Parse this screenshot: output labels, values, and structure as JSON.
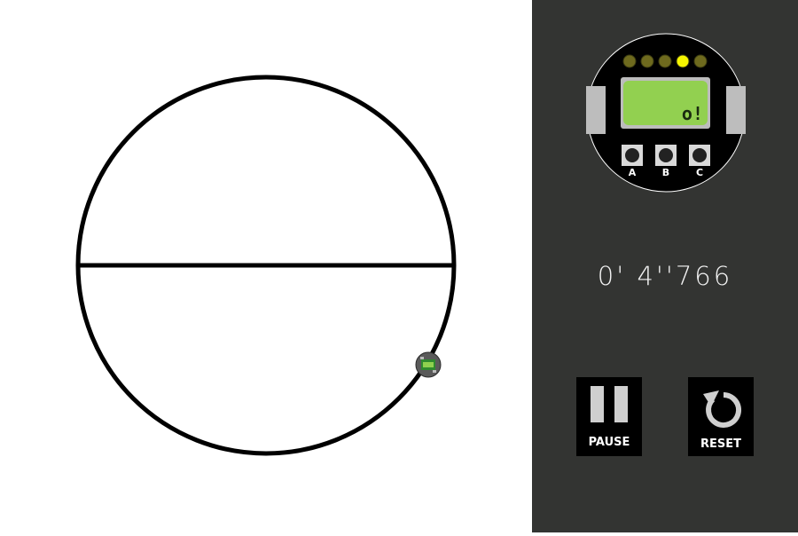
{
  "timer": {
    "text": "0' 4''766"
  },
  "robot": {
    "lcd_text": "o!",
    "button_labels": [
      "A",
      "B",
      "C"
    ],
    "leds": [
      {
        "name": "led-1",
        "on": false
      },
      {
        "name": "led-2",
        "on": false
      },
      {
        "name": "led-3",
        "on": false
      },
      {
        "name": "led-4",
        "on": true
      },
      {
        "name": "led-5",
        "on": false
      }
    ]
  },
  "controls": {
    "pause_label": "PAUSE",
    "reset_label": "RESET"
  },
  "colors": {
    "panel_bg": "#333432",
    "track": "#000000",
    "lcd": "#92d050",
    "led_on": "#f5f500",
    "led_off": "#6e6a1e",
    "button_bg": "#000000"
  },
  "icons": {
    "pause": "pause-icon",
    "reset": "reset-icon",
    "robot": "robot-icon"
  }
}
